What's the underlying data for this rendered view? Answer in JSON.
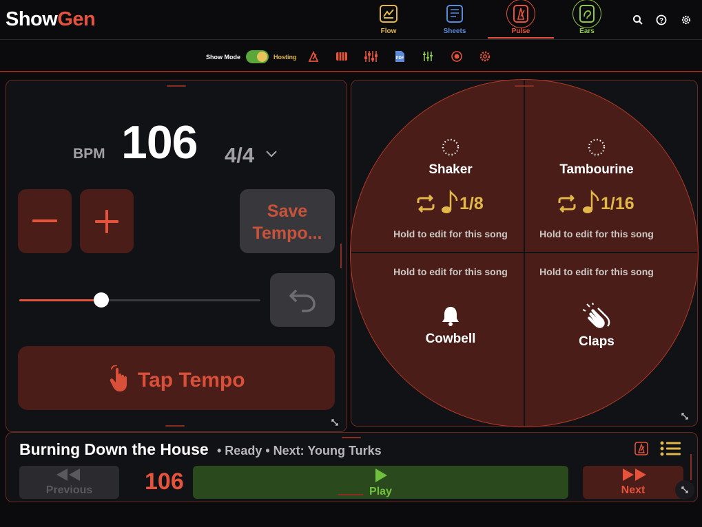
{
  "app": {
    "logo_part1": "Show",
    "logo_part2": "Gen"
  },
  "nav": {
    "tabs": [
      {
        "label": "Flow",
        "icon": "flow-icon",
        "color": "#e3b84a"
      },
      {
        "label": "Sheets",
        "icon": "sheets-icon",
        "color": "#5a8ad8"
      },
      {
        "label": "Pulse",
        "icon": "metronome-icon",
        "color": "#e5533c",
        "active": true
      },
      {
        "label": "Ears",
        "icon": "ears-icon",
        "color": "#8fc84a"
      }
    ],
    "right_icons": [
      "search-icon",
      "help-icon",
      "settings-icon"
    ]
  },
  "toolbar": {
    "show_mode_label": "Show Mode",
    "hosting_label": "Hosting",
    "show_mode_on": true,
    "icons": [
      "metronome-icon",
      "piano-icon",
      "mixer-icon",
      "pdf-icon",
      "equalizer-icon",
      "record-icon",
      "settings-icon"
    ]
  },
  "tempo": {
    "bpm_label": "BPM",
    "bpm_value": "106",
    "time_signature": "4/4",
    "slider_level": 0.34,
    "save_label_line1": "Save",
    "save_label_line2": "Tempo...",
    "tap_label": "Tap Tempo"
  },
  "instruments": {
    "shaker": {
      "name": "Shaker",
      "value": "1/8",
      "hint": "Hold to edit for this song"
    },
    "tambourine": {
      "name": "Tambourine",
      "value": "1/16",
      "hint": "Hold to edit for this song"
    },
    "cowbell": {
      "name": "Cowbell",
      "hint": "Hold to edit for this song"
    },
    "claps": {
      "name": "Claps",
      "hint": "Hold to edit for this song"
    }
  },
  "song": {
    "title": "Burning Down the House",
    "status": "• Ready • Next: Young Turks",
    "bpm": "106",
    "previous_label": "Previous",
    "play_label": "Play",
    "next_label": "Next"
  },
  "colors": {
    "accent": "#e5533c",
    "gold": "#e3b84a",
    "green": "#6fc13d",
    "panel_red": "#4a1d18"
  }
}
